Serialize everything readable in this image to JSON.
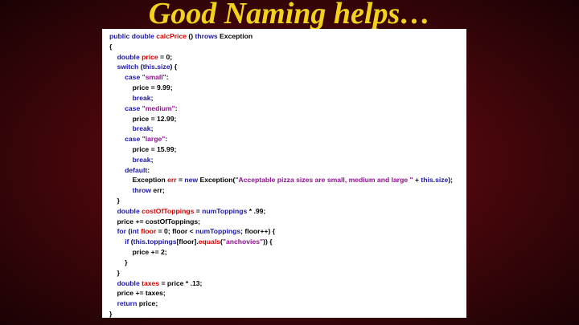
{
  "slide": {
    "title": "Good Naming helps…"
  },
  "code": {
    "lines": [
      [
        {
          "t": "public double ",
          "c": "kw"
        },
        {
          "t": "calcPrice",
          "c": "nm"
        },
        {
          "t": " () "
        },
        {
          "t": "throws",
          "c": "kw"
        },
        {
          "t": " Exception"
        }
      ],
      [
        {
          "t": "{"
        }
      ],
      [
        {
          "t": "    "
        },
        {
          "t": "double ",
          "c": "ty"
        },
        {
          "t": "price",
          "c": "nm"
        },
        {
          "t": " = 0;"
        }
      ],
      [
        {
          "t": "    "
        },
        {
          "t": "switch",
          "c": "kw"
        },
        {
          "t": " ("
        },
        {
          "t": "this",
          "c": "kw"
        },
        {
          "t": "."
        },
        {
          "t": "size",
          "c": "fld"
        },
        {
          "t": ") {"
        }
      ],
      [
        {
          "t": "        "
        },
        {
          "t": "case ",
          "c": "kw"
        },
        {
          "t": "\"small\"",
          "c": "str"
        },
        {
          "t": ":"
        }
      ],
      [
        {
          "t": "            price = 9.99;"
        }
      ],
      [
        {
          "t": "            "
        },
        {
          "t": "break",
          "c": "kw"
        },
        {
          "t": ";"
        }
      ],
      [
        {
          "t": "        "
        },
        {
          "t": "case ",
          "c": "kw"
        },
        {
          "t": "\"medium\"",
          "c": "str"
        },
        {
          "t": ":"
        }
      ],
      [
        {
          "t": "            price = 12.99;"
        }
      ],
      [
        {
          "t": "            "
        },
        {
          "t": "break",
          "c": "kw"
        },
        {
          "t": ";"
        }
      ],
      [
        {
          "t": "        "
        },
        {
          "t": "case ",
          "c": "kw"
        },
        {
          "t": "\"large\"",
          "c": "str"
        },
        {
          "t": ":"
        }
      ],
      [
        {
          "t": "            price = 15.99;"
        }
      ],
      [
        {
          "t": "            "
        },
        {
          "t": "break",
          "c": "kw"
        },
        {
          "t": ";"
        }
      ],
      [
        {
          "t": "        "
        },
        {
          "t": "default",
          "c": "kw"
        },
        {
          "t": ":"
        }
      ],
      [
        {
          "t": "            Exception "
        },
        {
          "t": "err",
          "c": "nm"
        },
        {
          "t": " = "
        },
        {
          "t": "new",
          "c": "kw"
        },
        {
          "t": " Exception("
        },
        {
          "t": "\"Acceptable pizza sizes are small, medium and large \"",
          "c": "str"
        },
        {
          "t": " + "
        },
        {
          "t": "this",
          "c": "kw"
        },
        {
          "t": "."
        },
        {
          "t": "size",
          "c": "fld"
        },
        {
          "t": ");"
        }
      ],
      [
        {
          "t": "            "
        },
        {
          "t": "throw",
          "c": "kw"
        },
        {
          "t": " err;"
        }
      ],
      [
        {
          "t": "    }"
        }
      ],
      [
        {
          "t": "    "
        },
        {
          "t": "double ",
          "c": "ty"
        },
        {
          "t": "costOfToppings",
          "c": "nm"
        },
        {
          "t": " = "
        },
        {
          "t": "numToppings",
          "c": "fld"
        },
        {
          "t": " * .99;"
        }
      ],
      [
        {
          "t": "    price += costOfToppings;"
        }
      ],
      [
        {
          "t": "    "
        },
        {
          "t": "for",
          "c": "kw"
        },
        {
          "t": " ("
        },
        {
          "t": "int",
          "c": "ty"
        },
        {
          "t": " "
        },
        {
          "t": "floor",
          "c": "nm"
        },
        {
          "t": " = 0; floor < "
        },
        {
          "t": "numToppings",
          "c": "fld"
        },
        {
          "t": "; floor++) {"
        }
      ],
      [
        {
          "t": "        "
        },
        {
          "t": "if",
          "c": "kw"
        },
        {
          "t": " ("
        },
        {
          "t": "this",
          "c": "kw"
        },
        {
          "t": "."
        },
        {
          "t": "toppings",
          "c": "fld"
        },
        {
          "t": "[floor]."
        },
        {
          "t": "equals",
          "c": "nm"
        },
        {
          "t": "("
        },
        {
          "t": "\"anchovies\"",
          "c": "str"
        },
        {
          "t": ")) {"
        }
      ],
      [
        {
          "t": "            price += 2;"
        }
      ],
      [
        {
          "t": "        }"
        }
      ],
      [
        {
          "t": "    }"
        }
      ],
      [
        {
          "t": "    "
        },
        {
          "t": "double ",
          "c": "ty"
        },
        {
          "t": "taxes",
          "c": "nm"
        },
        {
          "t": " = price * .13;"
        }
      ],
      [
        {
          "t": "    price += taxes;"
        }
      ],
      [
        {
          "t": "    "
        },
        {
          "t": "return",
          "c": "kw"
        },
        {
          "t": " price;"
        }
      ],
      [
        {
          "t": "}"
        }
      ]
    ]
  }
}
